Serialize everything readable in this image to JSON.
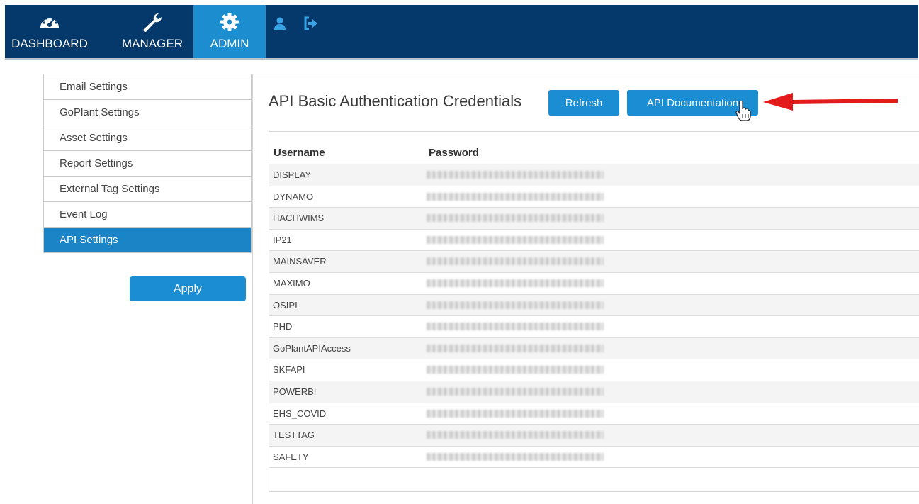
{
  "nav": {
    "items": [
      {
        "label": "DASHBOARD",
        "icon": "dashboard-gauge-icon"
      },
      {
        "label": "MANAGER",
        "icon": "wrench-icon"
      },
      {
        "label": "ADMIN",
        "icon": "gear-icon",
        "active": true
      }
    ],
    "utility_icons": [
      "user-icon",
      "logout-icon"
    ]
  },
  "sidebar": {
    "items": [
      {
        "label": "Email Settings"
      },
      {
        "label": "GoPlant Settings"
      },
      {
        "label": "Asset Settings"
      },
      {
        "label": "Report Settings"
      },
      {
        "label": "External Tag Settings"
      },
      {
        "label": "Event Log"
      },
      {
        "label": "API Settings",
        "active": true
      }
    ],
    "apply_label": "Apply"
  },
  "main": {
    "title": "API Basic Authentication Credentials",
    "refresh_label": "Refresh",
    "docs_label": "API Documentation",
    "table": {
      "headers": [
        "Username",
        "Password"
      ],
      "rows": [
        {
          "username": "DISPLAY"
        },
        {
          "username": "DYNAMO"
        },
        {
          "username": "HACHWIMS"
        },
        {
          "username": "IP21"
        },
        {
          "username": "MAINSAVER"
        },
        {
          "username": "MAXIMO"
        },
        {
          "username": "OSIPI"
        },
        {
          "username": "PHD"
        },
        {
          "username": "GoPlantAPIAccess"
        },
        {
          "username": "SKFAPI"
        },
        {
          "username": "POWERBI"
        },
        {
          "username": "EHS_COVID"
        },
        {
          "username": "TESTTAG"
        },
        {
          "username": "SAFETY"
        }
      ]
    }
  },
  "colors": {
    "nav_bg": "#05396b",
    "nav_active": "#1c8ed0",
    "button": "#1a8dd3",
    "sidebar_active": "#1a84c7",
    "annotation_arrow": "#e41b1b"
  }
}
